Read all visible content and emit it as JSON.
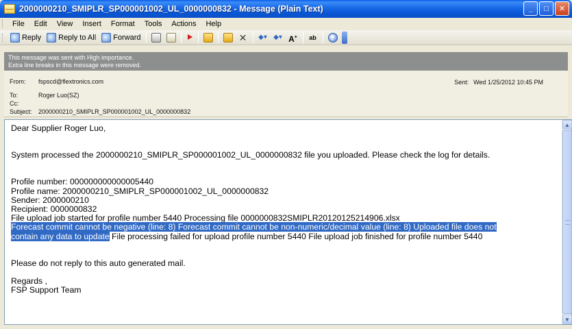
{
  "window": {
    "title": "2000000210_SMIPLR_SP000001002_UL_0000000832 - Message (Plain Text)"
  },
  "menu": [
    "File",
    "Edit",
    "View",
    "Insert",
    "Format",
    "Tools",
    "Actions",
    "Help"
  ],
  "toolbar": {
    "reply": "Reply",
    "reply_all": "Reply to All",
    "forward": "Forward"
  },
  "info": {
    "line1": "This message was sent with High importance.",
    "line2": "Extra line breaks in this message were removed."
  },
  "header": {
    "from_label": "From:",
    "from": "fspscd@flextronics.com",
    "to_label": "To:",
    "to": "Roger Luo(SZ)",
    "cc_label": "Cc:",
    "cc": "",
    "subject_label": "Subject:",
    "subject": "2000000210_SMIPLR_SP000001002_UL_0000000832",
    "sent_label": "Sent:",
    "sent": "Wed 1/25/2012 10:45 PM"
  },
  "message": {
    "greeting": "Dear Supplier Roger Luo,",
    "intro": "System processed the 2000000210_SMIPLR_SP000001002_UL_0000000832 file you uploaded. Please check the log for details.",
    "profile_number": "Profile number: 000000000000005440",
    "profile_name": "Profile name: 2000000210_SMIPLR_SP000001002_UL_0000000832",
    "sender": "Sender: 2000000210",
    "recipient": "Recipient: 0000000832",
    "upload_started": "File upload job started for profile number 5440 Processing file 0000000832SMIPLR20120125214906.xlsx",
    "error_line1": "Forecast commit cannot be negative (line: 8) Forecast commit cannot be non-numeric/decimal value (line: 8) Uploaded file does not",
    "error_line2": "contain any data to update",
    "failed": " File processing failed for upload profile number 5440 File upload job finished for profile number 5440",
    "noreply": "Please do not reply to this auto generated mail.",
    "regards": "Regards ,",
    "signature": "FSP Support Team"
  }
}
